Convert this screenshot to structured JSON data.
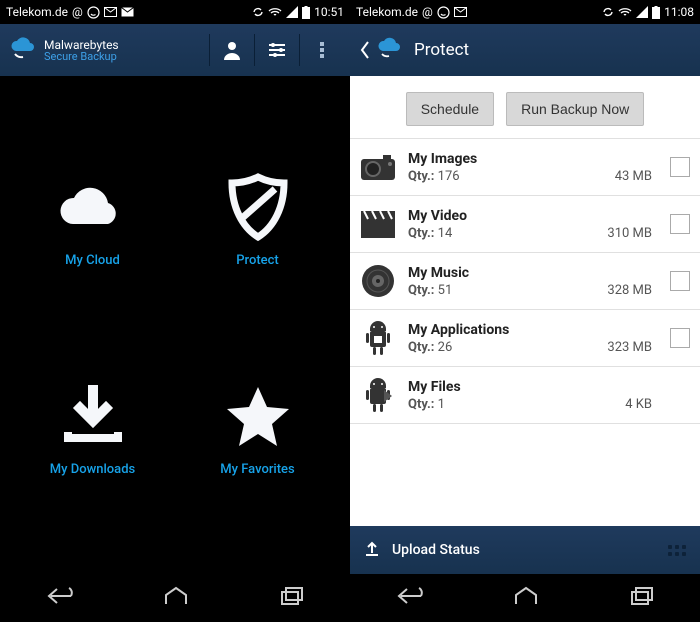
{
  "statusbar": {
    "carrier": "Telekom.de",
    "time_left": "10:51",
    "time_right": "11:08"
  },
  "screen1": {
    "app_title": "Malwarebytes",
    "app_subtitle": "Secure Backup",
    "tiles": {
      "my_cloud": "My Cloud",
      "protect": "Protect",
      "my_downloads": "My Downloads",
      "my_favorites": "My Favorites"
    }
  },
  "screen2": {
    "title": "Protect",
    "buttons": {
      "schedule": "Schedule",
      "run_backup": "Run Backup Now"
    },
    "qty_label": "Qty.:",
    "categories": [
      {
        "name": "My Images",
        "qty": "176",
        "size": "43 MB",
        "checkbox": true
      },
      {
        "name": "My Video",
        "qty": "14",
        "size": "310 MB",
        "checkbox": true
      },
      {
        "name": "My Music",
        "qty": "51",
        "size": "328 MB",
        "checkbox": true
      },
      {
        "name": "My Applications",
        "qty": "26",
        "size": "323 MB",
        "checkbox": true
      },
      {
        "name": "My Files",
        "qty": "1",
        "size": "4 KB",
        "checkbox": false
      }
    ],
    "upload_status": "Upload Status"
  }
}
